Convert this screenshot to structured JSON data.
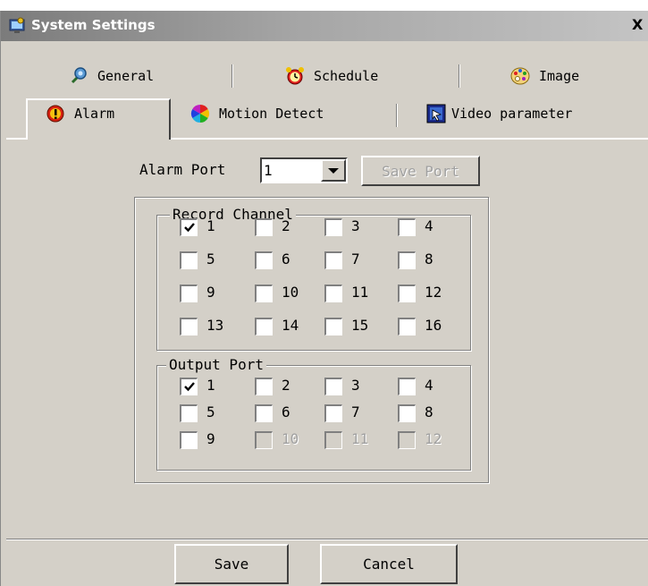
{
  "window": {
    "title": "System Settings",
    "close_glyph": "X"
  },
  "tabs": {
    "row_back": [
      {
        "label": "General",
        "icon": "general-icon"
      },
      {
        "label": "Schedule",
        "icon": "alarm-clock-icon"
      },
      {
        "label": "Image",
        "icon": "palette-icon"
      }
    ],
    "row_front": [
      {
        "label": "Alarm",
        "icon": "alarm-icon",
        "selected": true
      },
      {
        "label": "Motion Detect",
        "icon": "color-wheel-icon"
      },
      {
        "label": "Video parameter",
        "icon": "video-parameter-icon"
      }
    ]
  },
  "alarm_port": {
    "label": "Alarm Port",
    "selected_value": "1",
    "save_port_label": "Save Port"
  },
  "record_channel": {
    "title": "Record Channel",
    "checkboxes": [
      {
        "label": "1",
        "checked": true,
        "enabled": true
      },
      {
        "label": "2",
        "checked": false,
        "enabled": true
      },
      {
        "label": "3",
        "checked": false,
        "enabled": true
      },
      {
        "label": "4",
        "checked": false,
        "enabled": true
      },
      {
        "label": "5",
        "checked": false,
        "enabled": true
      },
      {
        "label": "6",
        "checked": false,
        "enabled": true
      },
      {
        "label": "7",
        "checked": false,
        "enabled": true
      },
      {
        "label": "8",
        "checked": false,
        "enabled": true
      },
      {
        "label": "9",
        "checked": false,
        "enabled": true
      },
      {
        "label": "10",
        "checked": false,
        "enabled": true
      },
      {
        "label": "11",
        "checked": false,
        "enabled": true
      },
      {
        "label": "12",
        "checked": false,
        "enabled": true
      },
      {
        "label": "13",
        "checked": false,
        "enabled": true
      },
      {
        "label": "14",
        "checked": false,
        "enabled": true
      },
      {
        "label": "15",
        "checked": false,
        "enabled": true
      },
      {
        "label": "16",
        "checked": false,
        "enabled": true
      }
    ]
  },
  "output_port": {
    "title": "Output Port",
    "checkboxes": [
      {
        "label": "1",
        "checked": true,
        "enabled": true
      },
      {
        "label": "2",
        "checked": false,
        "enabled": true
      },
      {
        "label": "3",
        "checked": false,
        "enabled": true
      },
      {
        "label": "4",
        "checked": false,
        "enabled": true
      },
      {
        "label": "5",
        "checked": false,
        "enabled": true
      },
      {
        "label": "6",
        "checked": false,
        "enabled": true
      },
      {
        "label": "7",
        "checked": false,
        "enabled": true
      },
      {
        "label": "8",
        "checked": false,
        "enabled": true
      },
      {
        "label": "9",
        "checked": false,
        "enabled": true
      },
      {
        "label": "10",
        "checked": false,
        "enabled": false
      },
      {
        "label": "11",
        "checked": false,
        "enabled": false
      },
      {
        "label": "12",
        "checked": false,
        "enabled": false
      }
    ]
  },
  "footer": {
    "save_label": "Save",
    "cancel_label": "Cancel"
  },
  "colors": {
    "dialog_face": "#d4d0c8",
    "titlebar_start": "#7b7b7b",
    "titlebar_end": "#c4c4c4",
    "disabled_text": "#a0a0a0"
  }
}
